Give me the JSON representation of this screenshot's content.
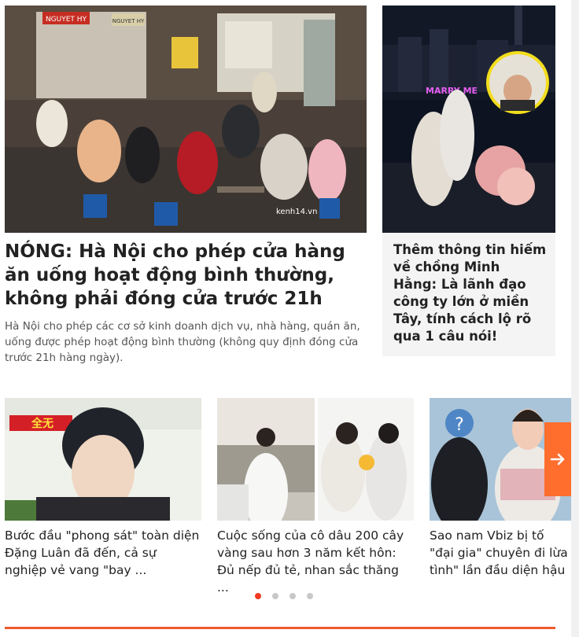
{
  "main_story": {
    "title": "NÓNG: Hà Nội cho phép cửa hàng ăn uống hoạt động bình thường, không phải đóng cửa trước 21h",
    "sapo": "Hà Nội cho phép các cơ sở kinh doanh dịch vụ, nhà hàng, quán ăn, uống được phép hoạt động bình thường (không quy định đóng cửa trước 21h hàng ngày).",
    "image_signs": [
      "NGUYET HY",
      "NGUYET HY"
    ],
    "watermark": "kenh14.vn"
  },
  "side_story": {
    "title": "Thêm thông tin hiếm về chồng Minh Hằng: Là lãnh đạo công ty lớn ở miền Tây, tính cách lộ rõ qua 1 câu nói!",
    "neon_sign": "MARRY ME"
  },
  "slider": {
    "items": [
      {
        "title": "Bước đầu \"phong sát\" toàn diện Đặng Luân đã đến, cả sự nghiệp vẻ vang \"bay ...",
        "image_text": "全无"
      },
      {
        "title": "Cuộc sống của cô dâu 200 cây vàng sau hơn 3 năm kết hôn: Đủ nếp đủ tẻ, nhan sắc thăng ..."
      },
      {
        "title": "Sao nam Vbiz bị tố \"đại gia\" chuyên đi lừa tình\" lần đầu diện hậu ..."
      }
    ],
    "next_icon": "arrow-right-icon",
    "page_count": 4,
    "active_page": 1
  },
  "colors": {
    "accent": "#ee5a2c",
    "next_button": "#ff6e2d",
    "dot_active": "#ee3b22",
    "dot_inactive": "#c8c8c8"
  }
}
